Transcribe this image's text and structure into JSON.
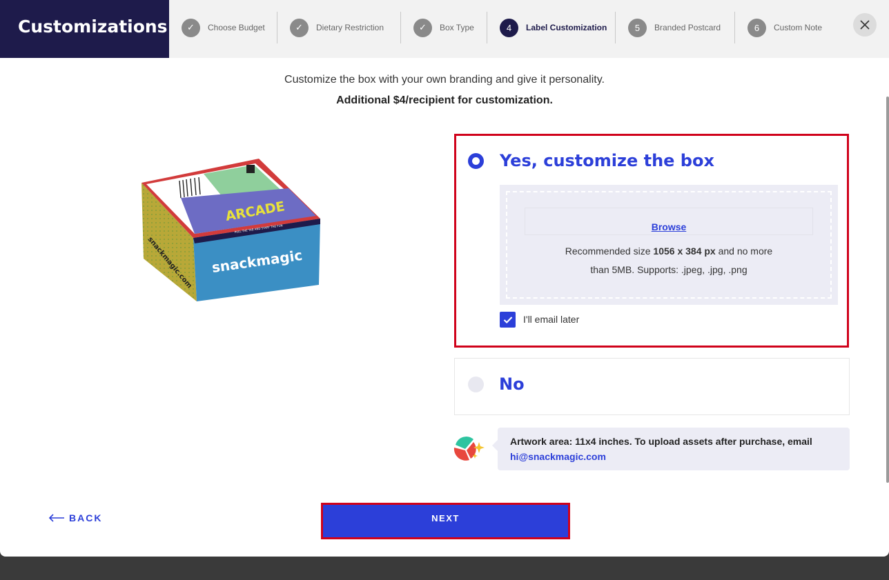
{
  "header": {
    "title": "Customizations",
    "steps": [
      {
        "label": "Choose Budget",
        "badge": "✓",
        "state": "done"
      },
      {
        "label": "Dietary Restriction",
        "badge": "✓",
        "state": "done"
      },
      {
        "label": "Box Type",
        "badge": "✓",
        "state": "done"
      },
      {
        "label": "Label Customization",
        "badge": "4",
        "state": "active"
      },
      {
        "label": "Branded Postcard",
        "badge": "5",
        "state": "upcoming"
      },
      {
        "label": "Custom Note",
        "badge": "6",
        "state": "upcoming"
      }
    ]
  },
  "intro": {
    "line1": "Customize the box with your own branding and give it personality.",
    "line2": "Additional $4/recipient for customization."
  },
  "box_art": {
    "brand_text": "snackmagic",
    "side_text": "snackmagic.com",
    "lid_text": "ARCADE",
    "strip_text": "PULL THE TAB AND START THE FUN"
  },
  "options": {
    "yes": {
      "label": "Yes, customize the box",
      "selected": true,
      "upload": {
        "browse_label": "Browse",
        "note_pre": "Recommended size ",
        "note_size": "1056 x 384 px",
        "note_mid": " and no more",
        "note_line2": "than 5MB. Supports: .jpeg, .jpg, .png"
      },
      "email_later": {
        "label": "I'll email later",
        "checked": true
      }
    },
    "no": {
      "label": "No",
      "selected": false
    }
  },
  "tip": {
    "text": "Artwork area: 11x4 inches. To upload assets after purchase, email ",
    "email": "hi@snackmagic.com"
  },
  "footer": {
    "back_label": "BACK",
    "next_label": "NEXT"
  },
  "colors": {
    "accent": "#2c3fd9",
    "brand_dark": "#1e1b4b",
    "highlight": "#d0021b"
  }
}
